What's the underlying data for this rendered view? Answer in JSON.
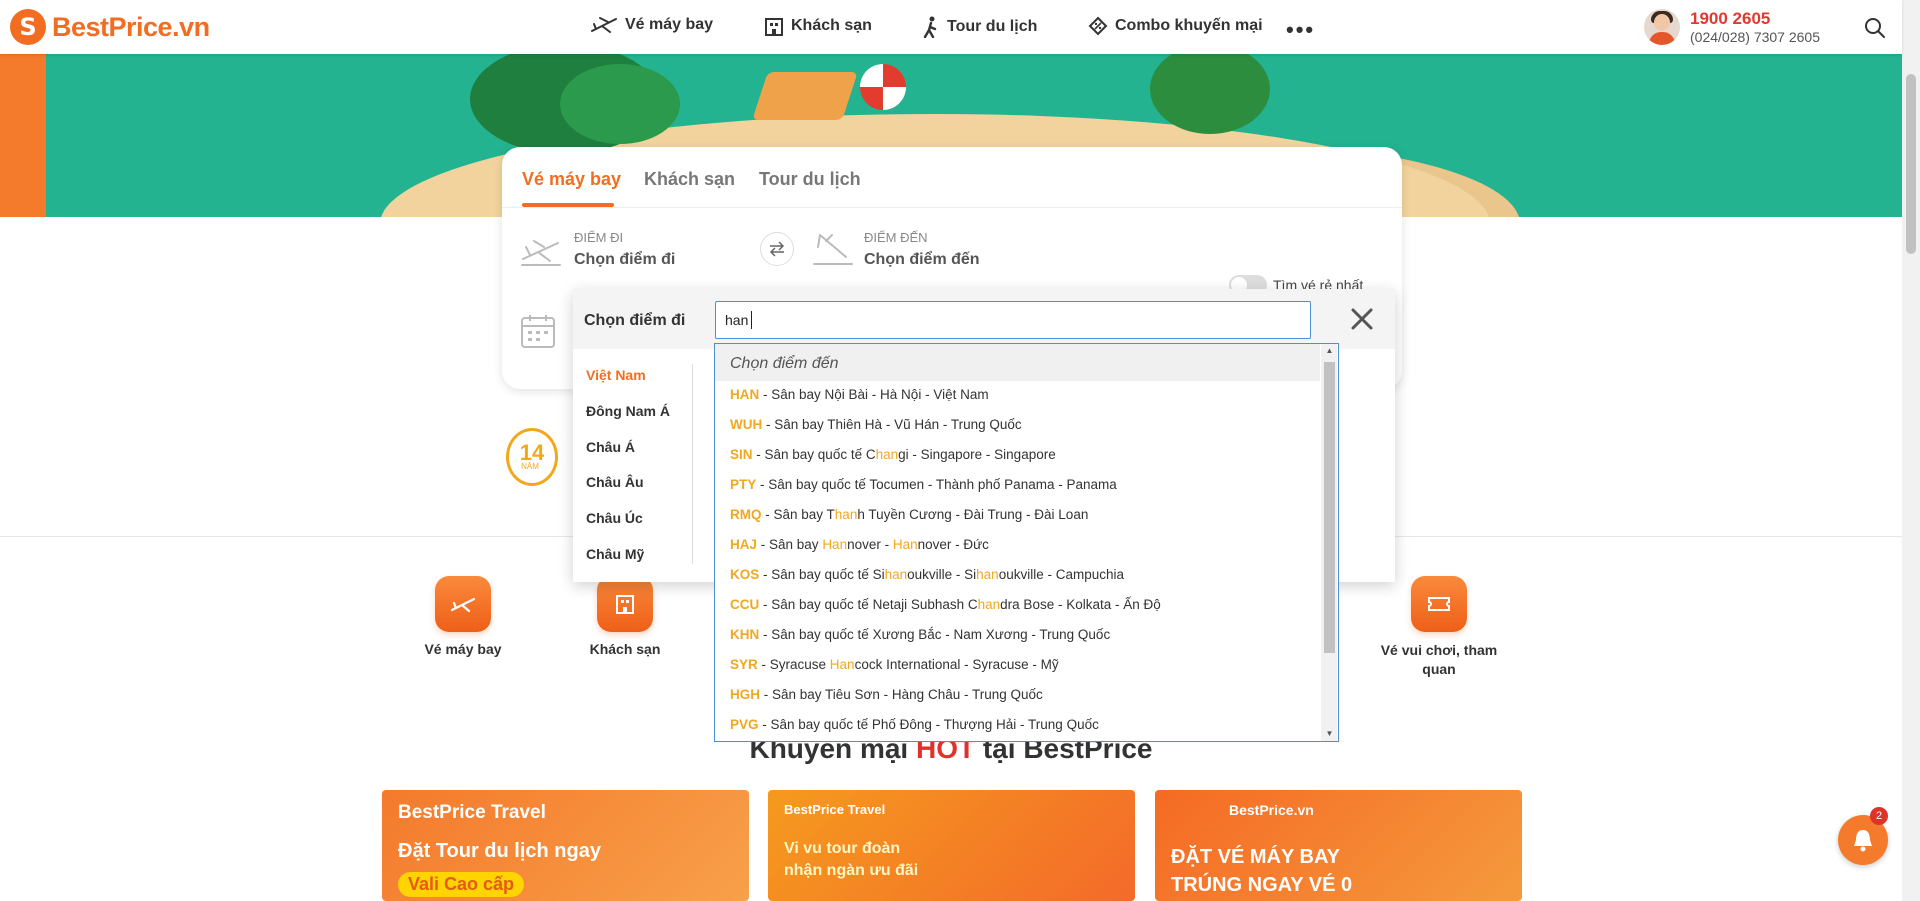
{
  "header": {
    "logo_letter": "S",
    "logo_text": "BestPrice.vn",
    "nav": [
      {
        "label": "Vé máy bay",
        "icon": "plane-icon"
      },
      {
        "label": "Khách sạn",
        "icon": "hotel-icon"
      },
      {
        "label": "Tour du lịch",
        "icon": "walker-icon"
      },
      {
        "label": "Combo khuyến mại",
        "icon": "discount-tag-icon"
      }
    ],
    "more": "•••",
    "hotline": "1900 2605",
    "hotline_sub": "(024/028) 7307 2605"
  },
  "search_card": {
    "tabs": [
      "Vé máy bay",
      "Khách sạn",
      "Tour du lịch"
    ],
    "active_tab": 0,
    "from_label": "ĐIỂM ĐI",
    "from_value": "Chọn điểm đi",
    "to_label": "ĐIỂM ĐẾN",
    "to_value": "Chọn điểm đến",
    "cheapest_toggle_label": "Tìm vé rẻ nhất",
    "cheapest_toggle_on": false
  },
  "departure_panel": {
    "title": "Chọn điểm đi",
    "query": "han",
    "regions": [
      "Việt Nam",
      "Đông Nam Á",
      "Châu Á",
      "Châu Âu",
      "Châu Úc",
      "Châu Mỹ"
    ],
    "active_region": 0
  },
  "results": {
    "header": "Chọn điểm đến",
    "items": [
      {
        "code": "HAN",
        "segments": [
          " - Sân bay Nội Bài - Hà Nội - Việt Nam"
        ]
      },
      {
        "code": "WUH",
        "segments": [
          " - Sân bay Thiên Hà - Vũ Hán - Trung Quốc"
        ]
      },
      {
        "code": "SIN",
        "segments": [
          " - Sân bay quốc tế C",
          "#han",
          "gi - Singapore - Singapore"
        ]
      },
      {
        "code": "PTY",
        "segments": [
          " - Sân bay quốc tế Tocumen - Thành phố Panama - Panama"
        ]
      },
      {
        "code": "RMQ",
        "segments": [
          " - Sân bay T",
          "#han",
          "h Tuyền Cương - Đài Trung - Đài Loan"
        ]
      },
      {
        "code": "HAJ",
        "segments": [
          " - Sân bay ",
          "#Han",
          "nover - ",
          "#Han",
          "nover - Đức"
        ]
      },
      {
        "code": "KOS",
        "segments": [
          " - Sân bay quốc tế Si",
          "#han",
          "oukville - Si",
          "#han",
          "oukville - Campuchia"
        ]
      },
      {
        "code": "CCU",
        "segments": [
          " - Sân bay quốc tế Netaji Subhash C",
          "#han",
          "dra Bose - Kolkata - Ấn Độ"
        ]
      },
      {
        "code": "KHN",
        "segments": [
          " - Sân bay quốc tế Xương Bắc - Nam Xương - Trung Quốc"
        ]
      },
      {
        "code": "SYR",
        "segments": [
          " - Syracuse ",
          "#Han",
          "cock International - Syracuse - Mỹ"
        ]
      },
      {
        "code": "HGH",
        "segments": [
          " - Sân bay Tiêu Sơn - Hàng Châu - Trung Quốc"
        ]
      },
      {
        "code": "PVG",
        "segments": [
          " - Sân bay quốc tế Phố Đông - Thượng Hải - Trung Quốc"
        ]
      }
    ]
  },
  "stats": {
    "years_number": "14",
    "years_unit": "NĂM"
  },
  "services": [
    {
      "label": "Vé máy bay",
      "icon": "plane-icon"
    },
    {
      "label": "Khách sạn",
      "icon": "hotel-icon"
    },
    {
      "label": "Vé vui chơi, tham quan",
      "icon": "ticket-icon"
    }
  ],
  "promo": {
    "title_pre": "Khuyến mại ",
    "title_hot": "HOT",
    "title_post": " tại BestPrice",
    "banners": [
      {
        "brand": "BestPrice Travel",
        "line1": "Đặt Tour du lịch ngay",
        "line2": "Vali Cao cấp"
      },
      {
        "brand": "BestPrice Travel",
        "line1": "Vi vu tour đoàn",
        "line2": "nhận ngàn ưu đãi"
      },
      {
        "brand": "BestPrice.vn",
        "line1": "ĐẶT VÉ MÁY BAY",
        "line2": "TRÚNG NGAY VÉ 0"
      }
    ]
  },
  "chat": {
    "badge": "2"
  },
  "colors": {
    "brand_orange": "#f26d21",
    "highlight": "#f2a81d",
    "hero_green": "#23b390",
    "hot_red": "#e0312b"
  }
}
